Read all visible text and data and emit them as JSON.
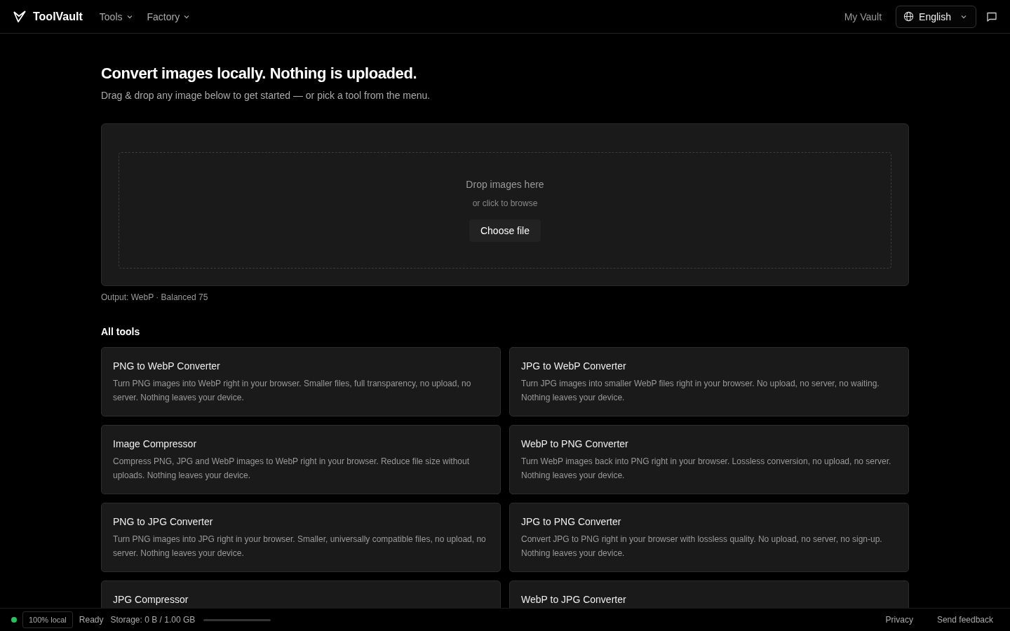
{
  "header": {
    "brand": "ToolVault",
    "nav": [
      {
        "label": "Tools"
      },
      {
        "label": "Factory"
      }
    ],
    "vault_link": "My Vault",
    "language": "English"
  },
  "hero": {
    "title": "Convert images locally. Nothing is uploaded.",
    "subtitle": "Drag & drop any image below to get started — or pick a tool from the menu."
  },
  "dropzone": {
    "title": "Drop images here",
    "hint": "or click to browse",
    "button": "Choose file"
  },
  "output_note": "Output: WebP · Balanced 75",
  "tools_heading": "All tools",
  "tools": [
    {
      "title": "PNG to WebP Converter",
      "description": "Turn PNG images into WebP right in your browser. Smaller files, full transparency, no upload, no server. Nothing leaves your device."
    },
    {
      "title": "JPG to WebP Converter",
      "description": "Turn JPG images into smaller WebP files right in your browser. No upload, no server, no waiting. Nothing leaves your device."
    },
    {
      "title": "Image Compressor",
      "description": "Compress PNG, JPG and WebP images to WebP right in your browser. Reduce file size without uploads. Nothing leaves your device."
    },
    {
      "title": "WebP to PNG Converter",
      "description": "Turn WebP images back into PNG right in your browser. Lossless conversion, no upload, no server. Nothing leaves your device."
    },
    {
      "title": "PNG to JPG Converter",
      "description": "Turn PNG images into JPG right in your browser. Smaller, universally compatible files, no upload, no server. Nothing leaves your device."
    },
    {
      "title": "JPG to PNG Converter",
      "description": "Convert JPG to PNG right in your browser with lossless quality. No upload, no server, no sign-up. Nothing leaves your device."
    },
    {
      "title": "JPG Compressor"
    },
    {
      "title": "WebP to JPG Converter"
    }
  ],
  "status_bar": {
    "online": true,
    "badge": "100% local",
    "status": "Ready",
    "storage": "Storage: 0 B / 1.00 GB",
    "storage_bar": {
      "level": 0
    },
    "links": [
      "Privacy",
      "Send feedback"
    ]
  }
}
